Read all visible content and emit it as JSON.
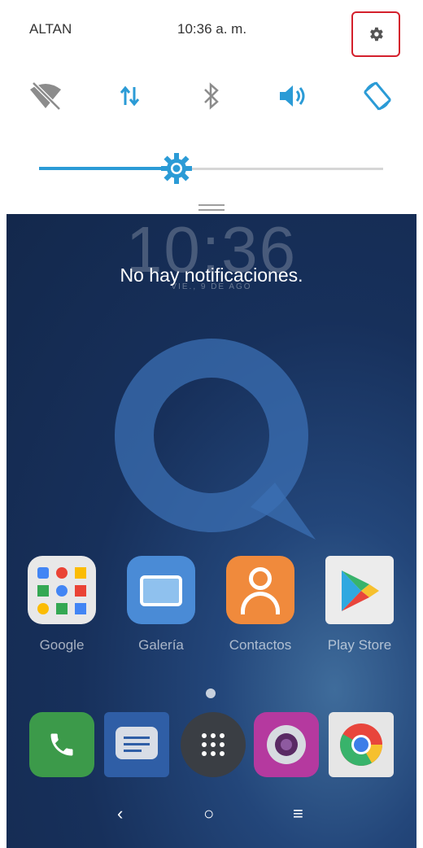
{
  "status_bar": {
    "carrier": "ALTAN",
    "time": "10:36 a. m."
  },
  "quick_settings": {
    "tiles": [
      "wifi-off-icon",
      "mobile-data-icon",
      "bluetooth-icon",
      "volume-icon",
      "auto-rotate-icon"
    ],
    "brightness_level": 0.4,
    "settings_icon": "gear-icon",
    "highlight_color": "#d4202c",
    "accent_color": "#2b9bd6"
  },
  "notifications": {
    "empty_text": "No hay notificaciones."
  },
  "home": {
    "clock": "10:36",
    "date": "VIE., 9 DE AGO",
    "apps": [
      {
        "label": "Google",
        "icon": "google-folder-icon"
      },
      {
        "label": "Galería",
        "icon": "gallery-icon"
      },
      {
        "label": "Contactos",
        "icon": "contacts-icon"
      },
      {
        "label": "Play Store",
        "icon": "play-store-icon"
      }
    ],
    "dock": [
      "phone-icon",
      "messages-icon",
      "app-drawer-icon",
      "camera-icon",
      "chrome-icon"
    ],
    "nav": {
      "back": "‹",
      "home": "○",
      "recents": "≡"
    }
  }
}
